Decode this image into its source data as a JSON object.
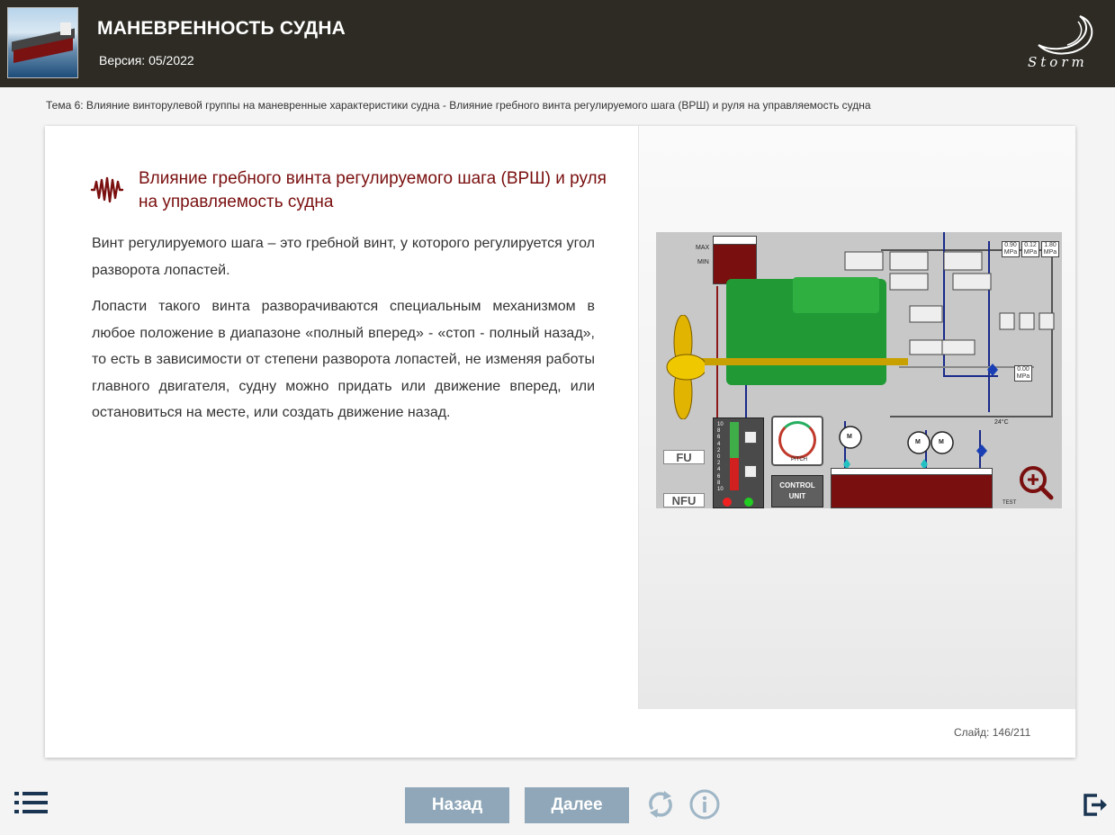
{
  "header": {
    "title": "МАНЕВРЕННОСТЬ СУДНА",
    "version": "Версия: 05/2022",
    "logo_text": "Storm"
  },
  "breadcrumb": "Тема 6: Влияние винторулевой группы на маневренные характеристики судна - Влияние гребного винта регулируемого шага (ВРШ) и руля на управляемость судна",
  "content": {
    "heading": "Влияние гребного винта регулируемого шага (ВРШ) и руля на управляемость судна",
    "paragraphs": [
      "Винт регулируемого шага – это гребной винт, у которого регулируется угол разворота лопастей.",
      "Лопасти такого винта разворачиваются специальным механизмом в любое положение в диапазоне «полный вперед» - «стоп - полный назад», то есть в зависимости от степени разворота лопастей, не изменяя работы главного двигателя, судну можно придать или движение вперед, или остановиться на месте, или создать движение назад."
    ],
    "slide_label": "Слайд:",
    "slide_current": "146",
    "slide_total": "211"
  },
  "schematic": {
    "tank_max": "MAX",
    "tank_min": "MIN",
    "fu_label": "FU",
    "nfu_label": "NFU",
    "control_unit": "CONTROL UNIT",
    "pitch_label": "PITCH",
    "temperature": "24°C",
    "test_label": "TEST",
    "pressures": [
      {
        "value": "0.90",
        "unit": "MPa"
      },
      {
        "value": "0.12",
        "unit": "MPa"
      },
      {
        "value": "1.80",
        "unit": "MPa"
      },
      {
        "value": "0.00",
        "unit": "MPa"
      }
    ],
    "motor_label": "M",
    "panel_scale": [
      "10",
      "8",
      "6",
      "4",
      "2",
      "0",
      "2",
      "4",
      "6",
      "8",
      "10"
    ]
  },
  "nav": {
    "back_label": "Назад",
    "next_label": "Далее"
  },
  "icons": {
    "menu": "list-menu-icon",
    "reload": "reload-icon",
    "info": "info-icon",
    "exit": "exit-icon",
    "heading": "wave-icon",
    "zoom": "zoom-in-icon"
  },
  "colors": {
    "header_bg": "#2d2b24",
    "accent": "#7a0f0f",
    "button": "#8fa7b8",
    "icon_blue": "#9fb6c6",
    "nav_dark": "#1a3552"
  }
}
